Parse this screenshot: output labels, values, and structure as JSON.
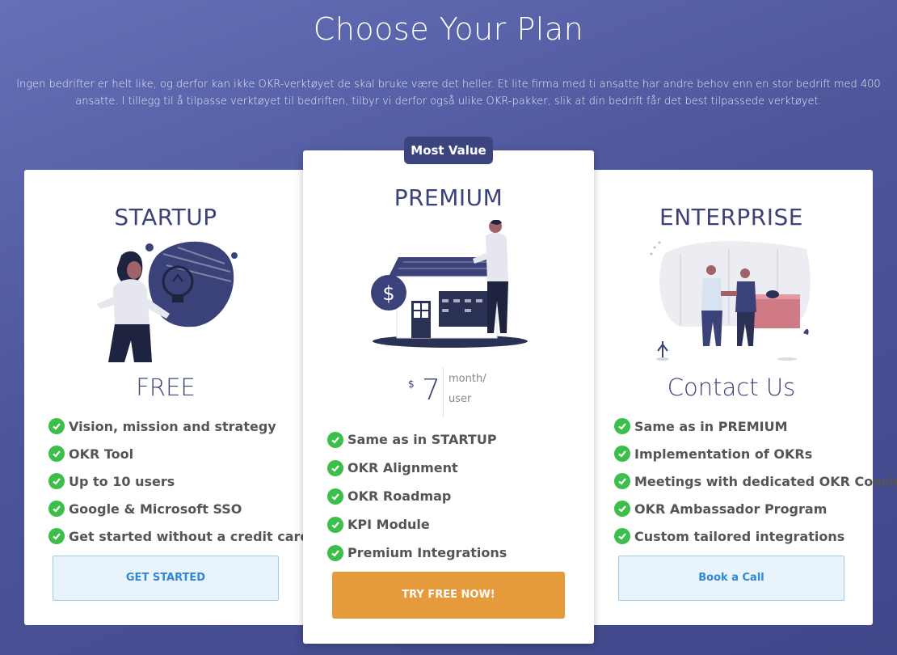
{
  "header": {
    "title": "Choose Your Plan",
    "intro": "Ingen bedrifter er helt like, og derfor kan ikke OKR-verktøyet de skal bruke være det heller. Et lite firma med ti ansatte har andre behov enn en stor bedrift med 400 ansatte. I tillegg til å tilpasse verktøyet til bedriften, tilbyr vi derfor også ulike OKR-pakker, slik at din bedrift får det best tilpassede verktøyet."
  },
  "plans": {
    "startup": {
      "name": "STARTUP",
      "price": "FREE",
      "features": [
        "Vision, mission and strategy",
        "OKR Tool",
        "Up to 10 users",
        "Google & Microsoft SSO",
        "Get started without a credit card"
      ],
      "button": "GET STARTED"
    },
    "premium": {
      "badge": "Most Value",
      "name": "PREMIUM",
      "currency": "$",
      "price": "7",
      "unit": "month/ user",
      "features": [
        "Same as in STARTUP",
        "OKR Alignment",
        "OKR Roadmap",
        "KPI Module",
        "Premium Integrations"
      ],
      "button": "TRY FREE NOW!"
    },
    "enterprise": {
      "name": "ENTERPRISE",
      "price": "Contact Us",
      "features": [
        "Same as in PREMIUM",
        "Implementation of OKRs",
        "Meetings with dedicated OKR Coach",
        "OKR Ambassador Program",
        "Custom tailored integrations"
      ],
      "button": "Book a Call"
    }
  },
  "colors": {
    "primary": "#3a4279",
    "check": "#3bbf4a",
    "cta": "#e59a3c",
    "link_button": "#2f87d6"
  },
  "icons": {
    "feature_check": "check-circle-icon",
    "startup_illustration": "woman-lightbulb-illustration",
    "premium_illustration": "man-house-dollar-illustration",
    "enterprise_illustration": "handshake-office-illustration"
  }
}
